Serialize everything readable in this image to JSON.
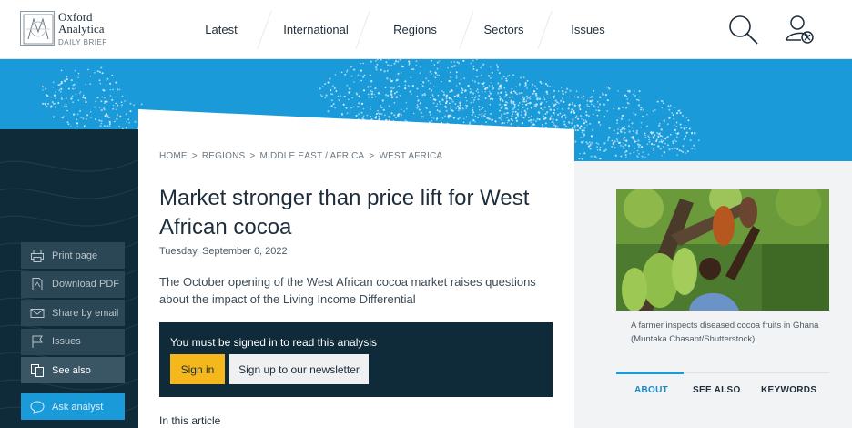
{
  "logo": {
    "line1": "Oxford",
    "line2": "Analytica",
    "sub": "DAILY BRIEF"
  },
  "nav": [
    "Latest",
    "International",
    "Regions",
    "Sectors",
    "Issues"
  ],
  "icons": {
    "search": "search-icon",
    "user": "user-close-icon"
  },
  "tools": [
    {
      "label": "Print page",
      "icon": "print-icon"
    },
    {
      "label": "Download PDF",
      "icon": "pdf-icon"
    },
    {
      "label": "Share by email",
      "icon": "email-icon"
    },
    {
      "label": "Issues",
      "icon": "flag-icon"
    },
    {
      "label": "See also",
      "icon": "documents-icon"
    }
  ],
  "ask_analyst": {
    "label": "Ask analyst",
    "icon": "chat-icon"
  },
  "breadcrumb": [
    "HOME",
    "REGIONS",
    "MIDDLE EAST / AFRICA",
    "WEST AFRICA"
  ],
  "article": {
    "title": "Market stronger than price lift for West African cocoa",
    "date": "Tuesday, September 6, 2022",
    "summary": "The October opening of the West African cocoa market raises questions about the impact of the Living Income Differential"
  },
  "signin": {
    "message": "You must be signed in to read this analysis",
    "signin_label": "Sign in",
    "newsletter_label": "Sign up to our newsletter"
  },
  "in_article": "In this article",
  "image": {
    "caption": "A farmer inspects diseased cocoa fruits in Ghana (Muntaka Chasant/Shutterstock)"
  },
  "tabs": [
    "ABOUT",
    "SEE ALSO",
    "KEYWORDS"
  ],
  "colors": {
    "accent": "#1a9ad9",
    "dark": "#0f2b3a",
    "signin": "#f5b81c"
  }
}
